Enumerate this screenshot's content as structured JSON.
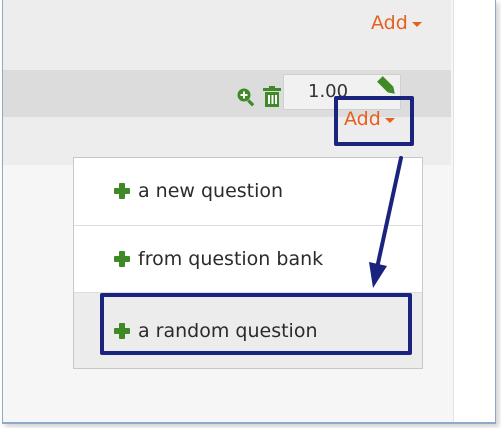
{
  "toolbar": {
    "top_add_label": "Add",
    "slot_add_label": "Add"
  },
  "slot": {
    "max_mark": "1.00",
    "icons": [
      "zoom-in-icon",
      "trash-icon",
      "pencil-icon"
    ]
  },
  "add_menu": {
    "items": [
      {
        "label": "a new question",
        "icon": "plus-icon"
      },
      {
        "label": "from question bank",
        "icon": "plus-icon"
      },
      {
        "label": "a random question",
        "icon": "plus-icon"
      }
    ]
  },
  "colors": {
    "accent_orange": "#e8601f",
    "icon_green": "#3f8a27",
    "highlight_navy": "#1a237e"
  }
}
